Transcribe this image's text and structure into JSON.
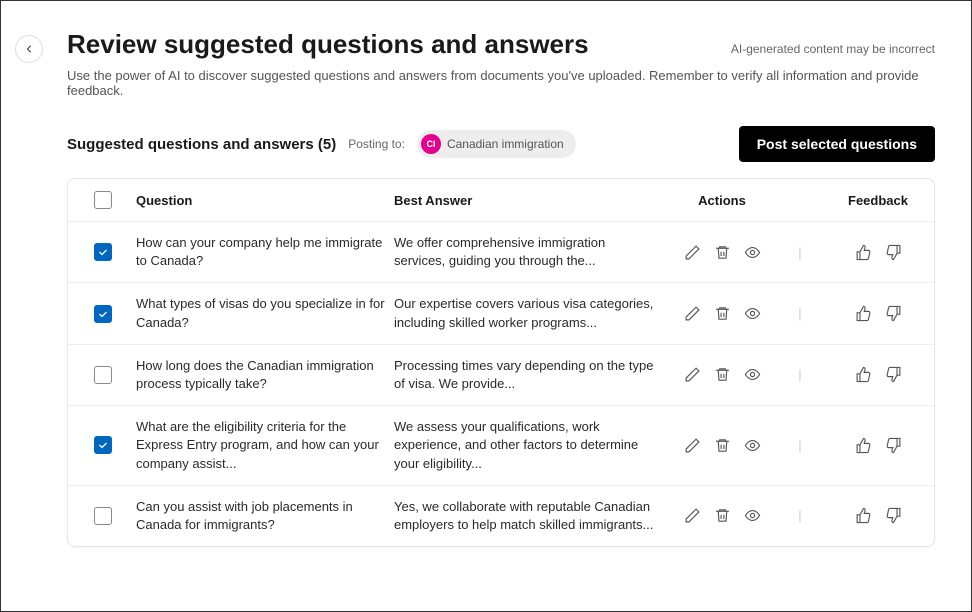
{
  "header": {
    "title": "Review suggested questions and answers",
    "ai_warning": "AI-generated content may be incorrect",
    "subtitle": "Use the power of AI to discover suggested questions and answers from documents you've uploaded. Remember to verify all information and provide feedback."
  },
  "toolbar": {
    "suggested_label": "Suggested questions and answers (5)",
    "posting_to_label": "Posting to:",
    "community_initials": "CI",
    "community_name": "Canadian immigration",
    "post_button_label": "Post selected questions"
  },
  "table": {
    "columns": {
      "question": "Question",
      "answer": "Best Answer",
      "actions": "Actions",
      "feedback": "Feedback"
    },
    "rows": [
      {
        "checked": true,
        "question": " How can your company help me immigrate to Canada?",
        "answer": "We offer comprehensive immigration services, guiding you through the..."
      },
      {
        "checked": true,
        "question": "What types of visas do you specialize in for Canada?",
        "answer": "Our expertise covers various visa categories, including skilled worker programs..."
      },
      {
        "checked": false,
        "question": "How long does the Canadian immigration process typically take?",
        "answer": "Processing times vary depending on the type of visa. We provide..."
      },
      {
        "checked": true,
        "question": "What are the eligibility criteria for the Express Entry program, and how can your company assist...",
        "answer": "We assess your qualifications, work experience, and other factors to determine your eligibility..."
      },
      {
        "checked": false,
        "question": "Can you assist with job placements in Canada for immigrants?",
        "answer": " Yes, we collaborate with reputable Canadian employers to help match skilled immigrants..."
      }
    ]
  }
}
